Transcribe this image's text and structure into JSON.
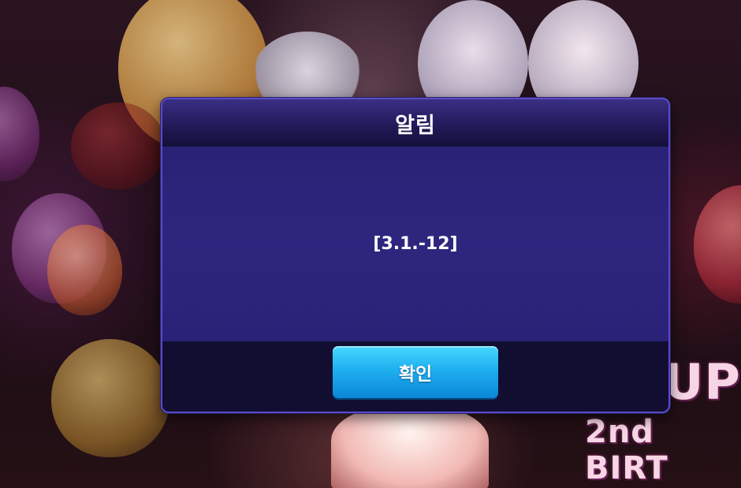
{
  "dialog": {
    "title": "알림",
    "message": "[3.1.-12]",
    "confirm_label": "확인"
  },
  "background": {
    "banner_line1": "UPI",
    "banner_line2": "2nd BIRT"
  },
  "colors": {
    "dialog_border": "#5a4bc8",
    "dialog_body": "#2a2276",
    "dialog_footer": "#120e32",
    "button_accent": "#1fb0f0"
  }
}
